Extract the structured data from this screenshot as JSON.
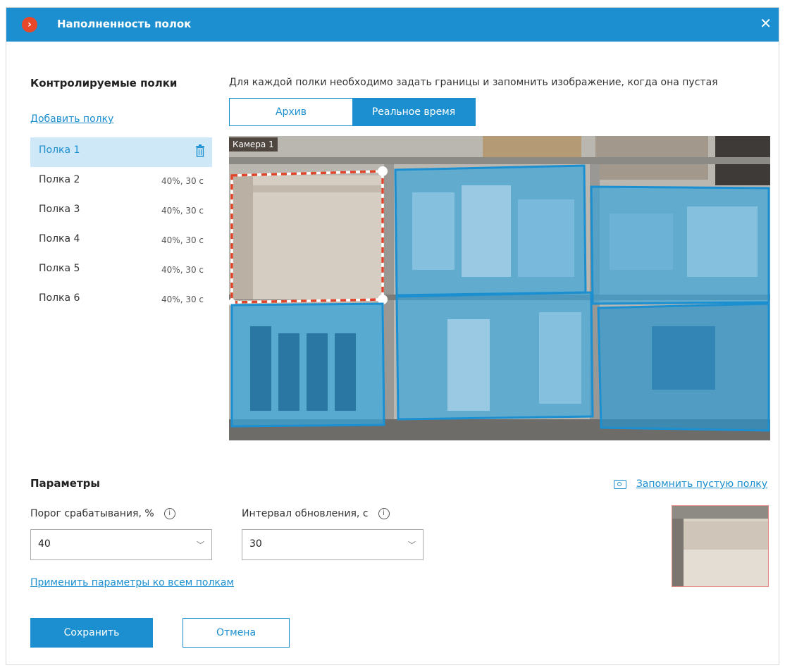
{
  "window": {
    "title": "Наполненность полок",
    "close_icon": "close-icon"
  },
  "left": {
    "heading": "Контролируемые полки",
    "add_link": "Добавить полку",
    "shelves": [
      {
        "name": "Полка 1",
        "value": ""
      },
      {
        "name": "Полка 2",
        "value": "40%, 30 с"
      },
      {
        "name": "Полка 3",
        "value": "40%, 30 с"
      },
      {
        "name": "Полка 4",
        "value": "40%, 30 с"
      },
      {
        "name": "Полка 5",
        "value": "40%, 30 с"
      },
      {
        "name": "Полка 6",
        "value": "40%, 30 с"
      }
    ]
  },
  "main": {
    "instruction": "Для каждой полки необходимо задать границы и запомнить изображение, когда она пустая",
    "tabs": [
      "Архив",
      "Реальное время"
    ],
    "active_tab": 1,
    "camera_label": "Камера 1"
  },
  "params": {
    "heading": "Параметры",
    "threshold_label": "Порог срабатывания, %",
    "threshold_value": "40",
    "interval_label": "Интервал обновления, с",
    "interval_value": "30",
    "apply_link": "Применить параметры ко всем полкам",
    "remember_link": "Запомнить пустую полку"
  },
  "buttons": {
    "save": "Сохранить",
    "cancel": "Отмена"
  },
  "colors": {
    "accent": "#1b8fd0",
    "selection": "#cfe8f7",
    "zone_dashed": "#e0452b",
    "logo": "#e8482a"
  }
}
